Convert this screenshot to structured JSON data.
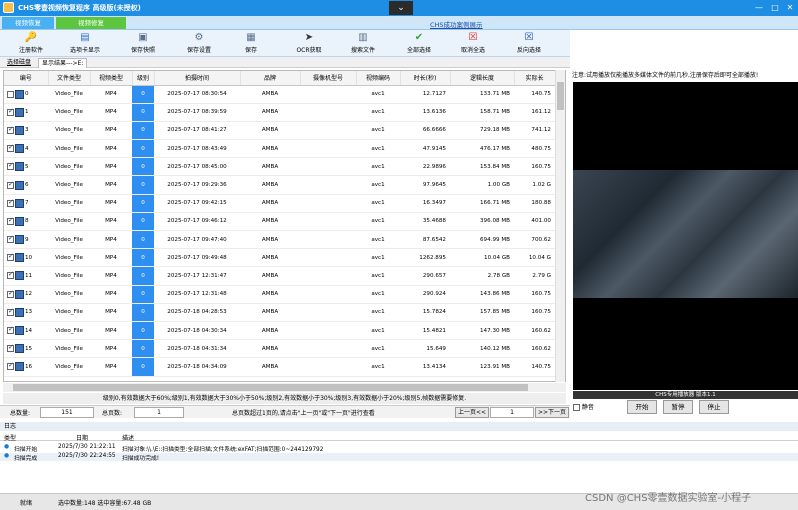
{
  "app_title": "CHS零壹视频恢复程序 高级版(未授权)",
  "tabs": [
    {
      "label": "视频恢复",
      "color": "#49b0f1"
    },
    {
      "label": "视频修复",
      "color": "#5cc63f"
    }
  ],
  "link_error": "CHS成功案例展示",
  "toolbar": [
    {
      "label": "注册软件",
      "icon": "key-icon"
    },
    {
      "label": "选项卡显示",
      "icon": "tab-icon"
    },
    {
      "label": "保存快照",
      "icon": "snapshot-icon"
    },
    {
      "label": "保存设置",
      "icon": "settings-icon"
    },
    {
      "label": "保存",
      "icon": "save-icon"
    },
    {
      "label": "OCR获取",
      "icon": "ocr-icon"
    },
    {
      "label": "搜索文件",
      "icon": "search-icon"
    },
    {
      "label": "全部选择",
      "icon": "check-all-icon"
    },
    {
      "label": "取消全选",
      "icon": "uncheck-icon"
    },
    {
      "label": "反向选择",
      "icon": "invert-icon"
    }
  ],
  "subtabs": [
    "选择磁盘",
    "显示结果--->E:"
  ],
  "columns": [
    "编号",
    "文件类型",
    "视频类型",
    "级别",
    "拍摄时间",
    "品牌",
    "摄像机型号",
    "视频编码",
    "时长(秒)",
    "逻辑长度",
    "实际长"
  ],
  "rows": [
    {
      "id": "0",
      "checked": false,
      "ftype": "Video_File",
      "vtype": "MP4",
      "level": "0",
      "time": "2025-07-17 08:30:54",
      "brand": "AMBA",
      "model": "",
      "codec": "avc1",
      "dur": "12.7127",
      "len": "133.71 MB",
      "act": "140.75"
    },
    {
      "id": "1",
      "checked": true,
      "ftype": "Video_File",
      "vtype": "MP4",
      "level": "0",
      "time": "2025-07-17 08:39:59",
      "brand": "AMBA",
      "model": "",
      "codec": "avc1",
      "dur": "13.6136",
      "len": "158.71 MB",
      "act": "161.12"
    },
    {
      "id": "3",
      "checked": true,
      "ftype": "Video_File",
      "vtype": "MP4",
      "level": "0",
      "time": "2025-07-17 08:41:27",
      "brand": "AMBA",
      "model": "",
      "codec": "avc1",
      "dur": "66.6666",
      "len": "729.18 MB",
      "act": "741.12"
    },
    {
      "id": "4",
      "checked": true,
      "ftype": "Video_File",
      "vtype": "MP4",
      "level": "0",
      "time": "2025-07-17 08:43:49",
      "brand": "AMBA",
      "model": "",
      "codec": "avc1",
      "dur": "47.9145",
      "len": "476.17 MB",
      "act": "480.75"
    },
    {
      "id": "5",
      "checked": true,
      "ftype": "Video_File",
      "vtype": "MP4",
      "level": "0",
      "time": "2025-07-17 08:45:00",
      "brand": "AMBA",
      "model": "",
      "codec": "avc1",
      "dur": "22.9896",
      "len": "153.84 MB",
      "act": "160.75"
    },
    {
      "id": "6",
      "checked": true,
      "ftype": "Video_File",
      "vtype": "MP4",
      "level": "0",
      "time": "2025-07-17 09:29:36",
      "brand": "AMBA",
      "model": "",
      "codec": "avc1",
      "dur": "97.9645",
      "len": "1.00 GB",
      "act": "1.02 G"
    },
    {
      "id": "7",
      "checked": true,
      "ftype": "Video_File",
      "vtype": "MP4",
      "level": "0",
      "time": "2025-07-17 09:42:15",
      "brand": "AMBA",
      "model": "",
      "codec": "avc1",
      "dur": "16.3497",
      "len": "166.71 MB",
      "act": "180.88"
    },
    {
      "id": "8",
      "checked": true,
      "ftype": "Video_File",
      "vtype": "MP4",
      "level": "0",
      "time": "2025-07-17 09:46:12",
      "brand": "AMBA",
      "model": "",
      "codec": "avc1",
      "dur": "35.4688",
      "len": "396.08 MB",
      "act": "401.00"
    },
    {
      "id": "9",
      "checked": true,
      "ftype": "Video_File",
      "vtype": "MP4",
      "level": "0",
      "time": "2025-07-17 09:47:40",
      "brand": "AMBA",
      "model": "",
      "codec": "avc1",
      "dur": "87.6542",
      "len": "694.99 MB",
      "act": "700.62"
    },
    {
      "id": "10",
      "checked": true,
      "ftype": "Video_File",
      "vtype": "MP4",
      "level": "0",
      "time": "2025-07-17 09:49:48",
      "brand": "AMBA",
      "model": "",
      "codec": "avc1",
      "dur": "1262.895",
      "len": "10.04 GB",
      "act": "10.04 G"
    },
    {
      "id": "11",
      "checked": true,
      "ftype": "Video_File",
      "vtype": "MP4",
      "level": "0",
      "time": "2025-07-17 12:31:47",
      "brand": "AMBA",
      "model": "",
      "codec": "avc1",
      "dur": "290.657",
      "len": "2.78 GB",
      "act": "2.79 G"
    },
    {
      "id": "12",
      "checked": true,
      "ftype": "Video_File",
      "vtype": "MP4",
      "level": "0",
      "time": "2025-07-17 12:31:48",
      "brand": "AMBA",
      "model": "",
      "codec": "avc1",
      "dur": "290.924",
      "len": "143.86 MB",
      "act": "160.75"
    },
    {
      "id": "13",
      "checked": true,
      "ftype": "Video_File",
      "vtype": "MP4",
      "level": "0",
      "time": "2025-07-18 04:28:53",
      "brand": "AMBA",
      "model": "",
      "codec": "avc1",
      "dur": "15.7824",
      "len": "157.85 MB",
      "act": "160.75"
    },
    {
      "id": "14",
      "checked": true,
      "ftype": "Video_File",
      "vtype": "MP4",
      "level": "0",
      "time": "2025-07-18 04:30:34",
      "brand": "AMBA",
      "model": "",
      "codec": "avc1",
      "dur": "15.4821",
      "len": "147.30 MB",
      "act": "160.62"
    },
    {
      "id": "15",
      "checked": true,
      "ftype": "Video_File",
      "vtype": "MP4",
      "level": "0",
      "time": "2025-07-18 04:31:34",
      "brand": "AMBA",
      "model": "",
      "codec": "avc1",
      "dur": "15.649",
      "len": "140.12 MB",
      "act": "160.62"
    },
    {
      "id": "16",
      "checked": true,
      "ftype": "Video_File",
      "vtype": "MP4",
      "level": "0",
      "time": "2025-07-18 04:34:09",
      "brand": "AMBA",
      "model": "",
      "codec": "avc1",
      "dur": "13.4134",
      "len": "123.91 MB",
      "act": "140.75"
    }
  ],
  "legend_note": "级别0,有效数据大于60%;级别1,有效数据大于30%小于50%;级别2,有效数据小于30%;级别3,有效数据小于20%;级别5,帧数据需要修复.",
  "pager": {
    "total_label": "总数量:",
    "total": "151",
    "pages_label": "总页数:",
    "pages": "1",
    "hint": "总页数超过1页的,请点击\"上一页\"或\"下一页\"进行查看",
    "prev": "上一页<<",
    "page_value": "1",
    "next": ">>下一页"
  },
  "player": {
    "note": "注意:试用播放仅能播放多媒体文件的前几秒,注册保存后即可全部播放!",
    "footer": "CHS专用播放器 版本1.1",
    "mute": "静音",
    "btn_start": "开始",
    "btn_pause": "暂停",
    "btn_stop": "停止"
  },
  "log": {
    "label": "日志",
    "headers": [
      "类型",
      "日期",
      "描述"
    ],
    "rows": [
      {
        "type": "扫描开始",
        "date": "2025/7/30 21:22:11",
        "desc": "扫描对象:\\\\.\\E::扫描类型:全部扫描;文件系统:exFAT;扫描范围:0~244129792"
      },
      {
        "type": "扫描完成",
        "date": "2025/7/30 22:24:55",
        "desc": "扫描成功完成!"
      }
    ]
  },
  "status": {
    "state": "就绪",
    "selected": "选中数量:148 选中容量:67.48 GB"
  },
  "watermark": "CSDN @CHS零壹数据实验室-小程子"
}
